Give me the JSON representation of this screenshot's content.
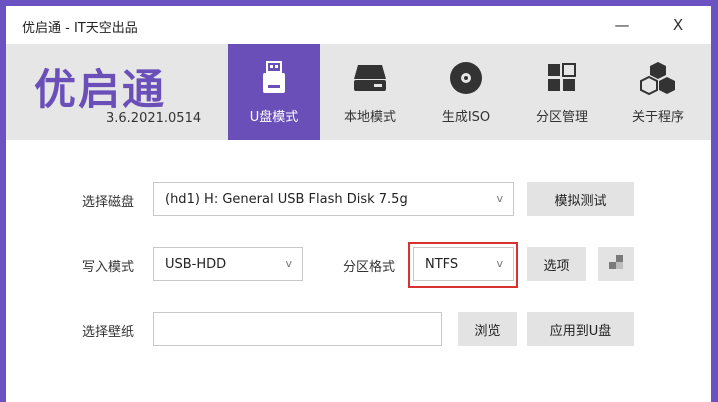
{
  "window": {
    "title": "优启通 - IT天空出品",
    "minimize_label": "—",
    "close_label": "X"
  },
  "header": {
    "logo_text": "优启通",
    "version": "3.6.2021.0514",
    "tabs": [
      {
        "label": "U盘模式",
        "icon": "usb-drive-icon",
        "active": true
      },
      {
        "label": "本地模式",
        "icon": "hard-disk-icon",
        "active": false
      },
      {
        "label": "生成ISO",
        "icon": "disc-icon",
        "active": false
      },
      {
        "label": "分区管理",
        "icon": "partition-grid-icon",
        "active": false
      },
      {
        "label": "关于程序",
        "icon": "cubes-icon",
        "active": false
      }
    ],
    "accent_color": "#6a4fb9"
  },
  "form": {
    "select_disk_label": "选择磁盘",
    "disk_value": "(hd1) H: General USB Flash Disk 7.5g",
    "simulate_test_label": "模拟测试",
    "write_mode_label": "写入模式",
    "write_mode_value": "USB-HDD",
    "partition_format_label": "分区格式",
    "partition_format_value": "NTFS",
    "options_label": "选项",
    "select_wallpaper_label": "选择壁纸",
    "wallpaper_value": "",
    "browse_label": "浏览",
    "apply_to_usb_label": "应用到U盘",
    "chevron": "v"
  }
}
